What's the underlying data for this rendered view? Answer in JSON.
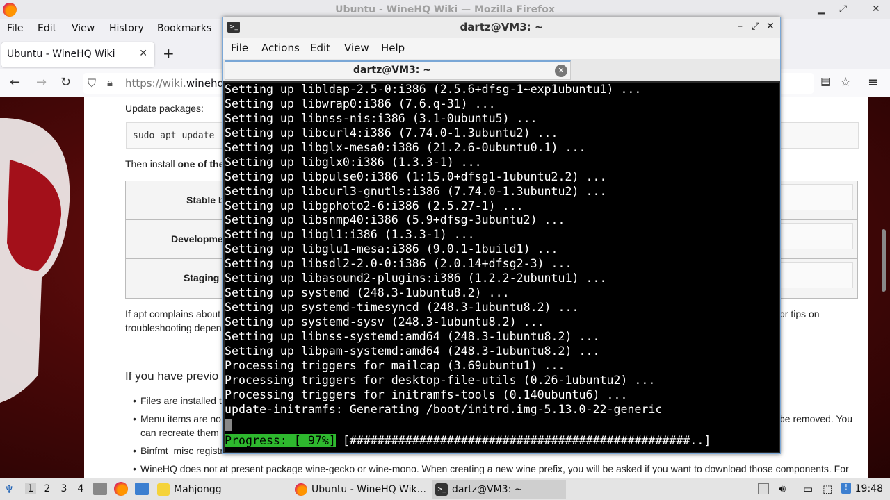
{
  "firefox": {
    "window_title": "Ubuntu - WineHQ Wiki — Mozilla Firefox",
    "menu": [
      "File",
      "Edit",
      "View",
      "History",
      "Bookmarks"
    ],
    "tab_title": "Ubuntu - WineHQ Wiki",
    "tab_close": "✕",
    "new_tab": "+",
    "url_prefix": "https://wiki.",
    "url_domain": "winehq."
  },
  "page": {
    "update_heading": "Update packages:",
    "code": "sudo apt update",
    "then_install_prefix": "Then install ",
    "then_install_bold": "one of the",
    "rows": [
      "Stable b",
      "Developme",
      "Staging"
    ],
    "apt_complains": "If apt complains about",
    "or_tips": "or tips on",
    "troubleshooting": "troubleshooting depen",
    "previous_heading": "If you have previo",
    "bullet1": "Files are installed t",
    "bullet2a": "Menu items are no",
    "bullet2b": "can recreate them",
    "bullet2_right": "be removed. You",
    "bullet3": "Binfmt_misc registr",
    "bullet4": "WineHQ does not at present package wine-gecko or wine-mono. When creating a new wine prefix, you will be asked if you want to download those components. For"
  },
  "terminal": {
    "title": "dartz@VM3: ~",
    "menu": [
      "File",
      "Actions",
      "Edit",
      "View",
      "Help"
    ],
    "tab_label": "dartz@VM3: ~",
    "lines": [
      "Setting up libldap-2.5-0:i386 (2.5.6+dfsg-1~exp1ubuntu1) ...",
      "Setting up libwrap0:i386 (7.6.q-31) ...",
      "Setting up libnss-nis:i386 (3.1-0ubuntu5) ...",
      "Setting up libcurl4:i386 (7.74.0-1.3ubuntu2) ...",
      "Setting up libglx-mesa0:i386 (21.2.6-0ubuntu0.1) ...",
      "Setting up libglx0:i386 (1.3.3-1) ...",
      "Setting up libpulse0:i386 (1:15.0+dfsg1-1ubuntu2.2) ...",
      "Setting up libcurl3-gnutls:i386 (7.74.0-1.3ubuntu2) ...",
      "Setting up libgphoto2-6:i386 (2.5.27-1) ...",
      "Setting up libsnmp40:i386 (5.9+dfsg-3ubuntu2) ...",
      "Setting up libgl1:i386 (1.3.3-1) ...",
      "Setting up libglu1-mesa:i386 (9.0.1-1build1) ...",
      "Setting up libsdl2-2.0-0:i386 (2.0.14+dfsg2-3) ...",
      "Setting up libasound2-plugins:i386 (1.2.2-2ubuntu1) ...",
      "Setting up systemd (248.3-1ubuntu8.2) ...",
      "Setting up systemd-timesyncd (248.3-1ubuntu8.2) ...",
      "Setting up systemd-sysv (248.3-1ubuntu8.2) ...",
      "Setting up libnss-systemd:amd64 (248.3-1ubuntu8.2) ...",
      "Setting up libpam-systemd:amd64 (248.3-1ubuntu8.2) ...",
      "Processing triggers for mailcap (3.69ubuntu1) ...",
      "Processing triggers for desktop-file-utils (0.26-1ubuntu2) ...",
      "Processing triggers for initramfs-tools (0.140ubuntu6) ...",
      "update-initramfs: Generating /boot/initrd.img-5.13.0-22-generic"
    ],
    "progress_label": "Progress: [ 97%]",
    "progress_bar": " [#################################################..]",
    "progress_value": 0.97
  },
  "taskbar": {
    "workspaces": [
      "1",
      "2",
      "3",
      "4"
    ],
    "tasks": {
      "mahjongg": "Mahjongg",
      "firefox": "Ubuntu - WineHQ Wik...",
      "terminal": "dartz@VM3: ~"
    },
    "clock": "19:48"
  },
  "icons": [
    "firefox-icon",
    "terminal-icon",
    "reader-view-icon",
    "bookmark-star-icon",
    "hamburger-menu-icon",
    "back-icon",
    "forward-icon",
    "reload-icon",
    "shield-icon",
    "lock-icon",
    "volume-icon",
    "network-icon",
    "start-menu-icon"
  ],
  "colors": {
    "progress_green": "#2eb82e",
    "focus_border": "#7aa7d6",
    "wine_red": "#7a1010"
  }
}
